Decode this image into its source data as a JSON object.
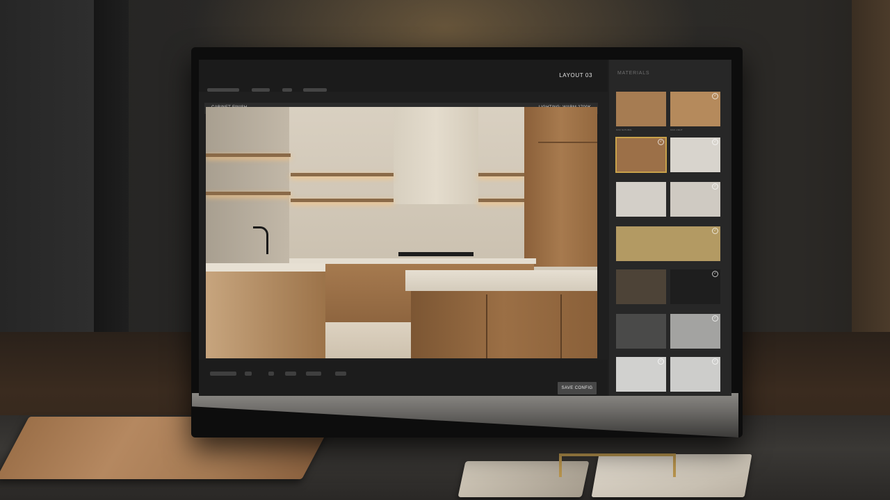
{
  "app": {
    "layout_label": "LAYOUT 03",
    "view_title": "CABINET FINISH",
    "lighting_label": "LIGHTING: WARM 2700K",
    "save_button_label": "SAVE CONFIG"
  },
  "materials": {
    "heading": "MATERIALS",
    "swatches": [
      {
        "color": "#a67c52",
        "label": "OAK NATURAL",
        "checked": false,
        "selected": false
      },
      {
        "color": "#b58a5c",
        "label": "OAK LIGHT",
        "checked": true,
        "selected": false
      },
      {
        "color": "#9c7048",
        "label": "",
        "checked": true,
        "selected": true
      },
      {
        "color": "#d8d4cd",
        "label": "",
        "checked": true,
        "selected": false
      },
      {
        "color": "#d3cfc8",
        "label": "",
        "checked": false,
        "selected": false
      },
      {
        "color": "#cfcac2",
        "label": "",
        "checked": true,
        "selected": false
      },
      {
        "color": "#b39a63",
        "label": "",
        "checked": true,
        "selected": false
      },
      {
        "color": "#4d4337",
        "label": "",
        "checked": false,
        "selected": false
      },
      {
        "color": "#1e1e1e",
        "label": "",
        "checked": true,
        "selected": false
      },
      {
        "color": "#4a4a49",
        "label": "",
        "checked": false,
        "selected": false
      },
      {
        "color": "#a3a3a1",
        "label": "",
        "checked": true,
        "selected": false
      },
      {
        "color": "#d1d1cf",
        "label": "",
        "checked": true,
        "selected": false
      },
      {
        "color": "#cdcdcb",
        "label": "",
        "checked": true,
        "selected": false
      }
    ]
  }
}
